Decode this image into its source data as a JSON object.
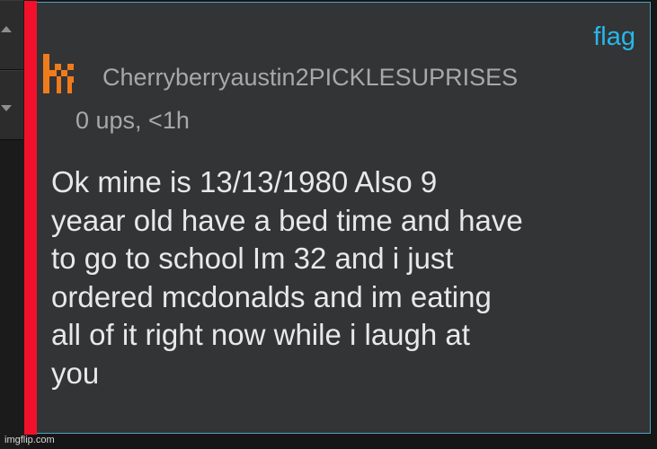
{
  "comment": {
    "flag_label": "flag",
    "username": "Cherryberryaustin2PICKLESUPRISES",
    "meta": "0 ups, <1h",
    "body_lines": [
      "Ok mine is 13/13/1980 Also 9",
      "yeaar old have a bed time and have",
      "to go to school Im 32 and i just",
      "ordered mcdonalds and im eating",
      "all of it right now while i laugh at",
      "you"
    ]
  },
  "watermark": "imgflip.com",
  "colors": {
    "accent_bar": "#f2102a",
    "flag_link": "#27b7ec",
    "card_border": "#4aa2c7",
    "avatar": "#f07b1d"
  }
}
